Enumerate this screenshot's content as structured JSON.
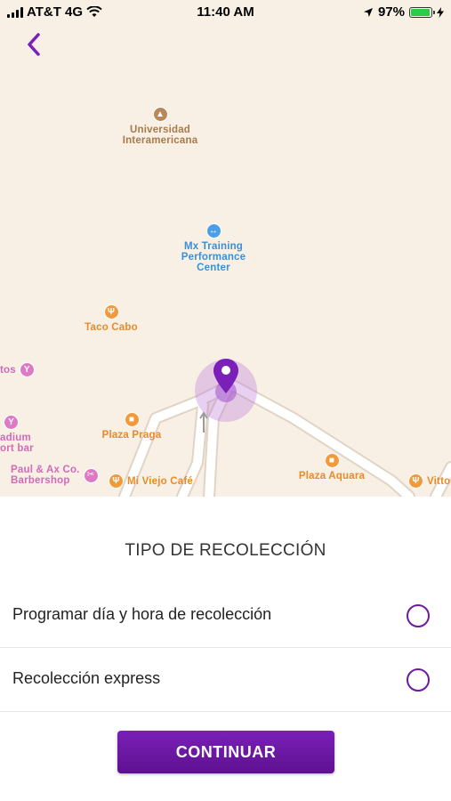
{
  "status_bar": {
    "carrier": "AT&T 4G",
    "time": "11:40 AM",
    "battery": "97%",
    "battery_level": 0.97
  },
  "map": {
    "pois": [
      {
        "id": "universidad",
        "label_line1": "Universidad",
        "label_line2": "Interamericana",
        "icon": "graduation-cap-icon"
      },
      {
        "id": "mx-training",
        "label_line1": "Mx Training",
        "label_line2": "Performance",
        "label_line3": "Center",
        "icon": "dumbbell-icon"
      },
      {
        "id": "taco-cabo",
        "label": "Taco Cabo",
        "icon": "fork-knife-icon"
      },
      {
        "id": "cocktail-left",
        "label": "tos",
        "icon": "cocktail-icon"
      },
      {
        "id": "stadium-bar",
        "label_line1": "adium",
        "label_line2": "ort bar",
        "icon": "cocktail-icon"
      },
      {
        "id": "plaza-praga",
        "label": "Plaza Praga",
        "icon": "shopping-bag-icon"
      },
      {
        "id": "paul-ax",
        "label_line1": "Paul & Ax Co.",
        "label_line2": "Barbershop",
        "icon": "scissors-icon"
      },
      {
        "id": "mi-viejo-cafe",
        "label": "Mi Viejo Café",
        "icon": "fork-knife-icon"
      },
      {
        "id": "plaza-aquara",
        "label": "Plaza Aquara",
        "icon": "shopping-bag-icon"
      },
      {
        "id": "vitto",
        "label": "Vitto",
        "icon": "fork-knife-icon"
      }
    ]
  },
  "panel": {
    "title": "TIPO DE RECOLECCIÓN",
    "options": [
      {
        "label": "Programar día y hora de recolección",
        "selected": false
      },
      {
        "label": "Recolección express",
        "selected": false
      }
    ],
    "continue_label": "CONTINUAR"
  },
  "colors": {
    "accent": "#6d1aa0",
    "button": "#6a16a4",
    "map_background": "#f8f0e4"
  }
}
